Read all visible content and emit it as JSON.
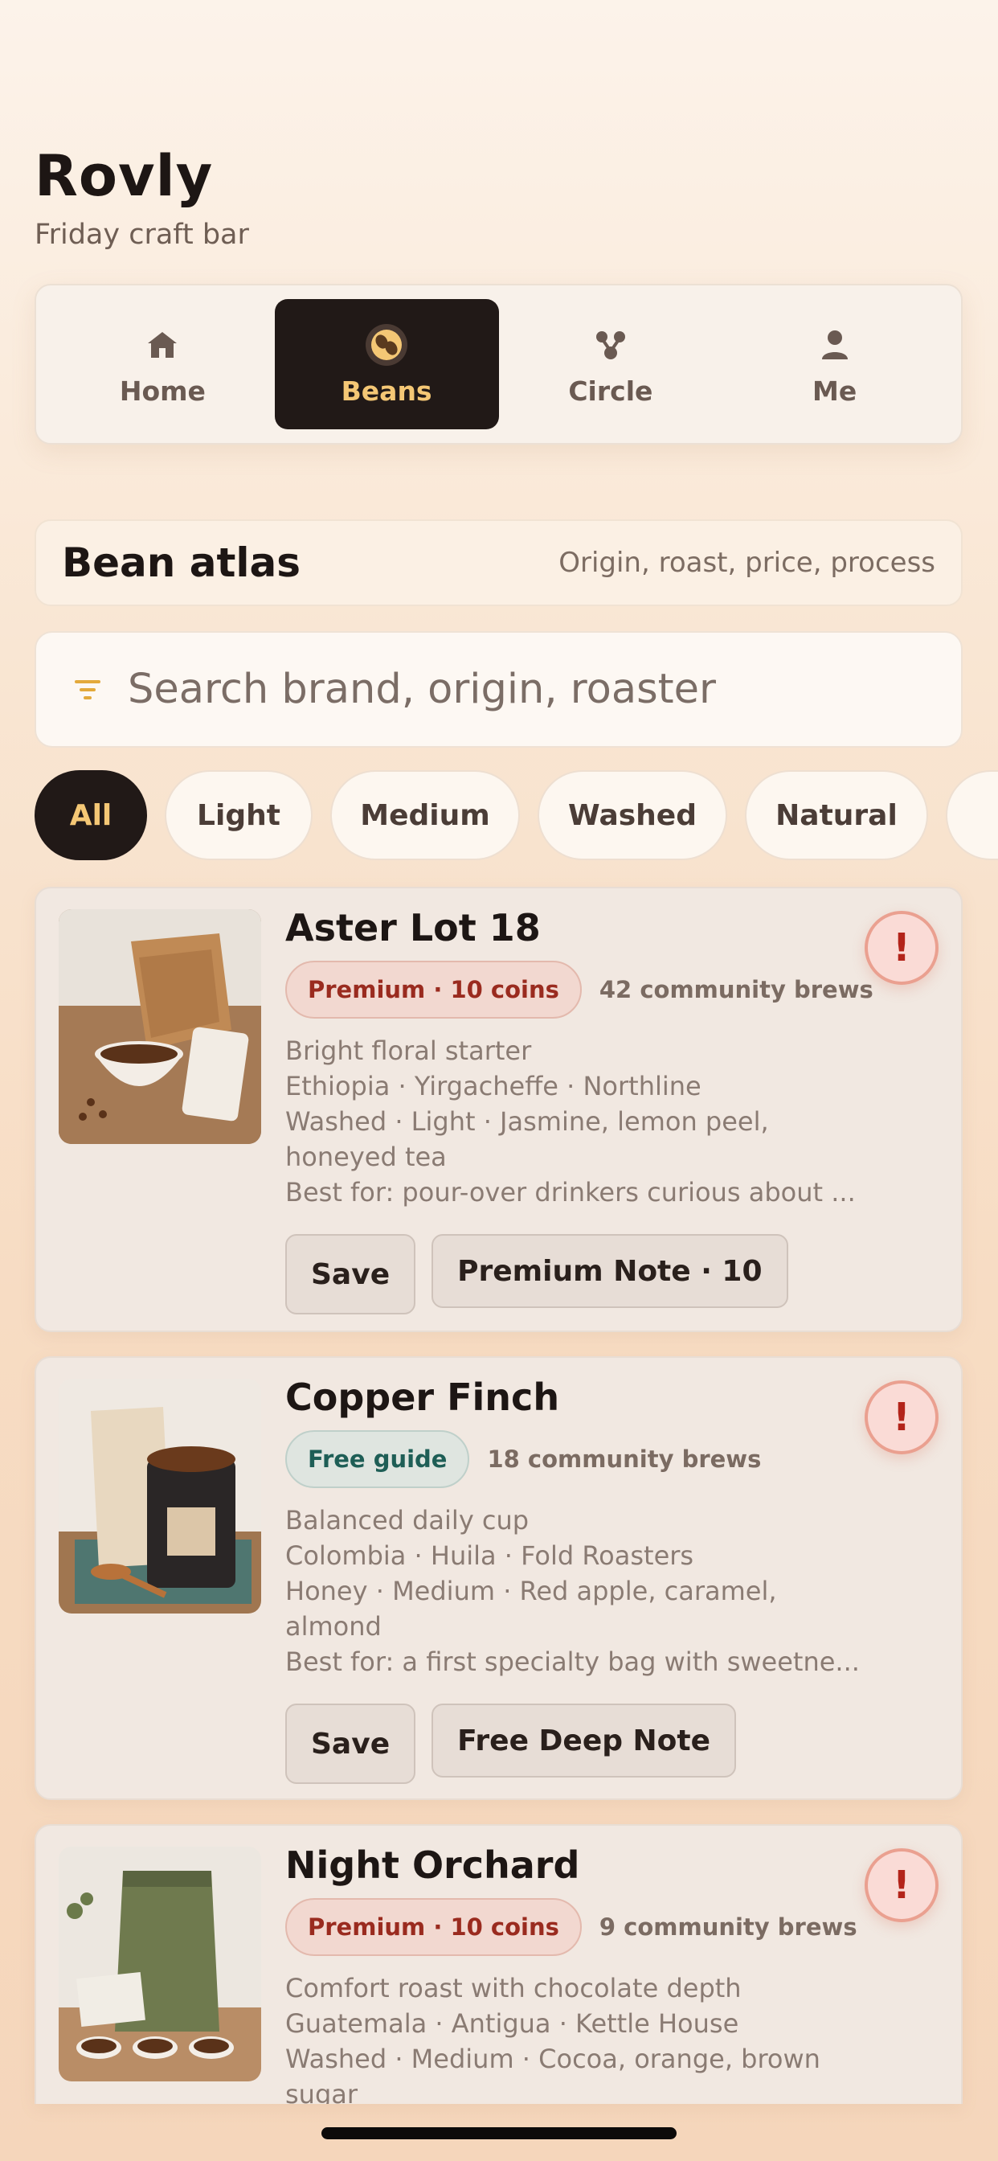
{
  "app": {
    "title": "Rovly",
    "subtitle": "Friday craft bar"
  },
  "nav": {
    "items": [
      {
        "label": "Home",
        "icon": "home-icon"
      },
      {
        "label": "Beans",
        "icon": "bean-icon",
        "active": true
      },
      {
        "label": "Circle",
        "icon": "circle-icon"
      },
      {
        "label": "Me",
        "icon": "person-icon"
      }
    ]
  },
  "section": {
    "title": "Bean atlas",
    "subtitle": "Origin, roast, price, process"
  },
  "search": {
    "placeholder": "Search brand, origin, roaster",
    "icon": "filter-icon"
  },
  "filters": [
    "All",
    "Light",
    "Medium",
    "Washed",
    "Natural"
  ],
  "active_filter": "All",
  "cards": [
    {
      "name": "Aster Lot 18",
      "badge": "Premium · 10 coins",
      "badge_type": "premium",
      "brews": "42 community brews",
      "tagline": "Bright floral starter",
      "origin": "Ethiopia · Yirgacheffe · Northline",
      "profile": "Washed · Light · Jasmine, lemon peel, honeyed tea",
      "best_for": "Best for: pour-over drinkers curious about ...",
      "save_label": "Save",
      "note_label": "Premium Note · 10"
    },
    {
      "name": "Copper Finch",
      "badge": "Free guide",
      "badge_type": "free",
      "brews": "18 community brews",
      "tagline": "Balanced daily cup",
      "origin": "Colombia · Huila · Fold Roasters",
      "profile": "Honey · Medium · Red apple, caramel, almond",
      "best_for": "Best for: a first specialty bag with sweetne...",
      "save_label": "Save",
      "note_label": "Free Deep Note"
    },
    {
      "name": "Night Orchard",
      "badge": "Premium · 10 coins",
      "badge_type": "premium",
      "brews": "9 community brews",
      "tagline": "Comfort roast with chocolate depth",
      "origin": "Guatemala · Antigua · Kettle House",
      "profile": "Washed · Medium · Cocoa, orange, brown sugar"
    }
  ],
  "alert_glyph": "!",
  "colors": {
    "accent": "#f4c775",
    "dark": "#211917",
    "premium": "#9a2b1f",
    "free": "#1e5e56",
    "alert": "#b3241a"
  }
}
